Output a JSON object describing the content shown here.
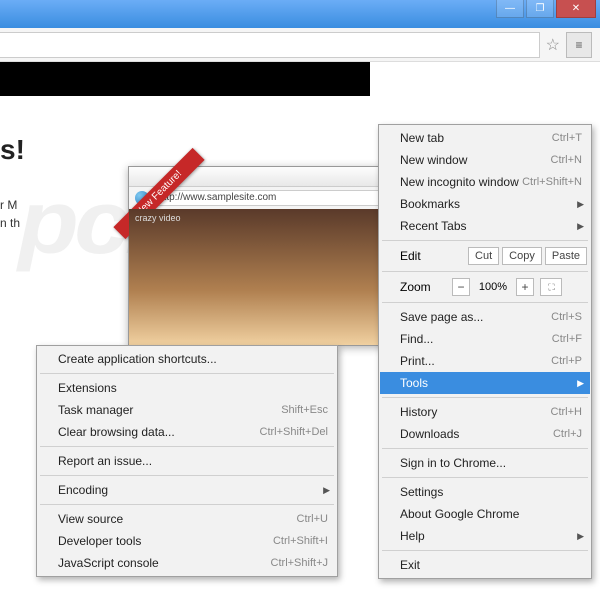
{
  "window": {
    "min": "—",
    "max": "❐",
    "close": "✕"
  },
  "toolbar": {
    "star": "☆",
    "menu": "≡"
  },
  "page": {
    "headline_suffix": "s!",
    "para_l1_prefix": "r M",
    "para_l2_prefix": "n th"
  },
  "preview": {
    "url": "http://www.samplesite.com",
    "body_label": "crazy video",
    "ribbon": "New Feature!"
  },
  "menu": {
    "new_tab": "New tab",
    "new_tab_sc": "Ctrl+T",
    "new_window": "New window",
    "new_window_sc": "Ctrl+N",
    "new_incognito": "New incognito window",
    "new_incognito_sc": "Ctrl+Shift+N",
    "bookmarks": "Bookmarks",
    "recent_tabs": "Recent Tabs",
    "edit": "Edit",
    "cut": "Cut",
    "copy": "Copy",
    "paste": "Paste",
    "zoom": "Zoom",
    "zoom_val": "100%",
    "zoom_minus": "−",
    "zoom_plus": "+",
    "zoom_fs": "⛶",
    "save": "Save page as...",
    "save_sc": "Ctrl+S",
    "find": "Find...",
    "find_sc": "Ctrl+F",
    "print": "Print...",
    "print_sc": "Ctrl+P",
    "tools": "Tools",
    "history": "History",
    "history_sc": "Ctrl+H",
    "downloads": "Downloads",
    "downloads_sc": "Ctrl+J",
    "sign_in": "Sign in to Chrome...",
    "settings": "Settings",
    "about": "About Google Chrome",
    "help": "Help",
    "exit": "Exit"
  },
  "submenu": {
    "create_shortcuts": "Create application shortcuts...",
    "extensions": "Extensions",
    "task_manager": "Task manager",
    "task_manager_sc": "Shift+Esc",
    "clear_browsing": "Clear browsing data...",
    "clear_browsing_sc": "Ctrl+Shift+Del",
    "report_issue": "Report an issue...",
    "encoding": "Encoding",
    "view_source": "View source",
    "view_source_sc": "Ctrl+U",
    "dev_tools": "Developer tools",
    "dev_tools_sc": "Ctrl+Shift+I",
    "js_console": "JavaScript console",
    "js_console_sc": "Ctrl+Shift+J"
  },
  "watermark": "pcrisk.com"
}
